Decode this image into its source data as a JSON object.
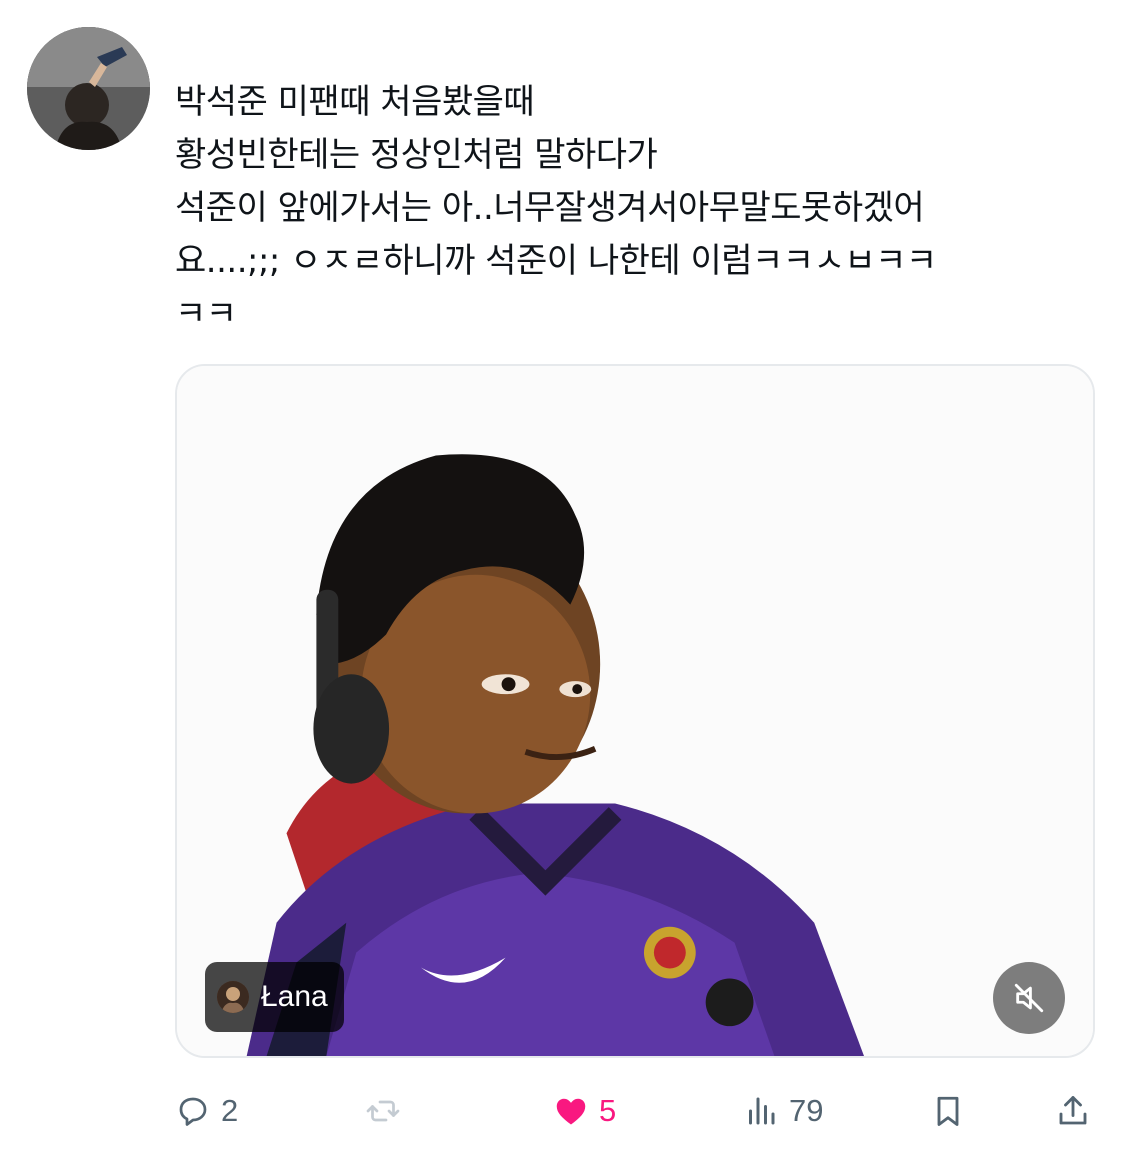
{
  "tweet": {
    "lines": [
      "박석준 미팬때 처음봤을때",
      "황성빈한테는 정상인처럼 말하다가",
      "석준이 앞에가서는 아..너무잘생겨서아무말도못하겠어",
      "요....;;; ㅇㅈㄹ하니까 석준이 나한테 이럼ㅋㅋㅅㅂㅋㅋ",
      "ㅋㅋ"
    ]
  },
  "media": {
    "source_name": "Łana"
  },
  "actions": {
    "reply_count": "2",
    "retweet_count": "",
    "like_count": "5",
    "views_count": "79"
  },
  "colors": {
    "text": "#0f1419",
    "muted": "#536471",
    "like": "#f91880",
    "border": "#e6e9ec"
  },
  "icons": {
    "reply": "speech-bubble-icon",
    "retweet": "retweet-icon",
    "like": "heart-icon",
    "views": "bar-chart-icon",
    "bookmark": "bookmark-icon",
    "share": "share-icon",
    "mute": "speaker-muted-icon"
  }
}
